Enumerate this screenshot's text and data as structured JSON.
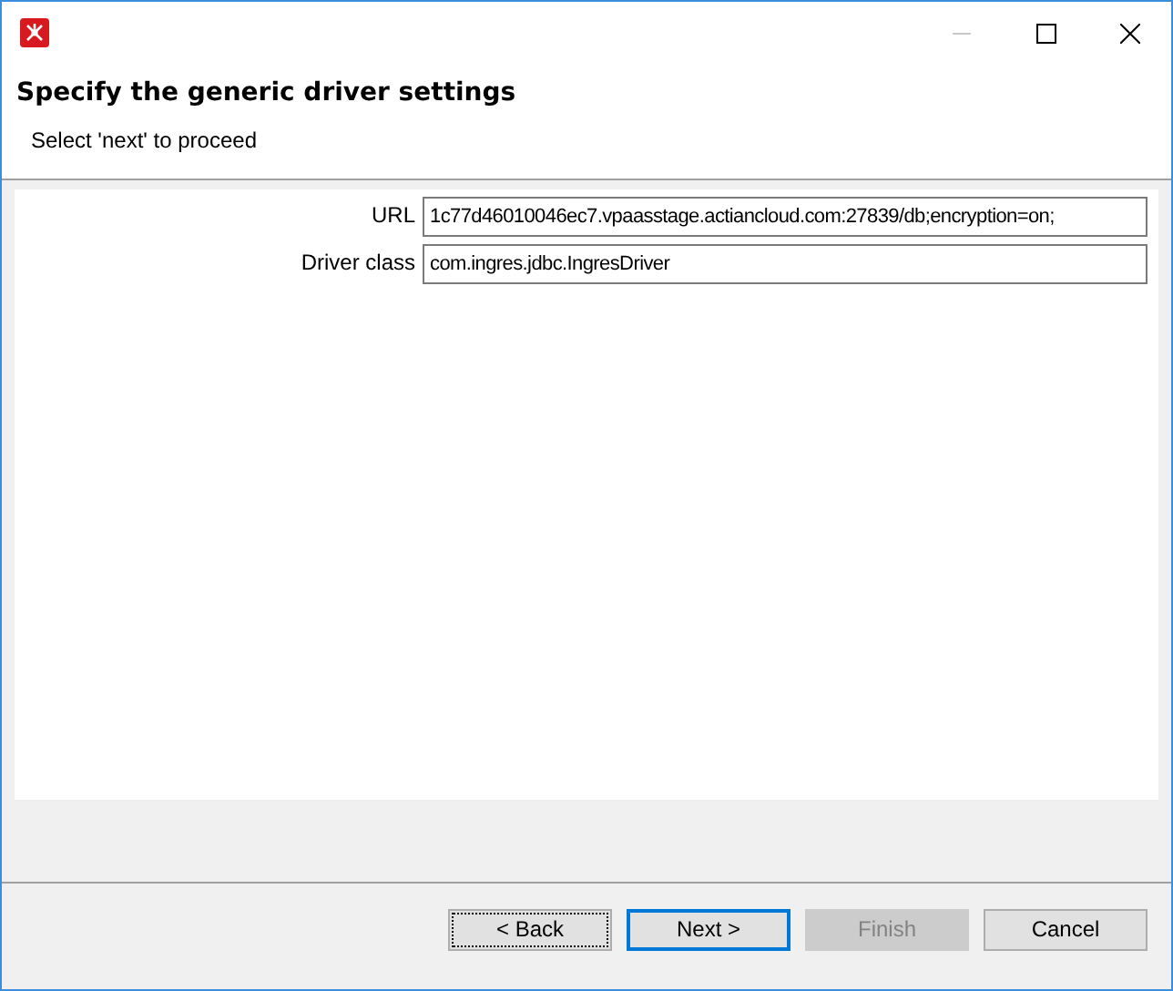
{
  "header": {
    "title": "Specify the generic driver settings",
    "subtitle": "Select 'next' to proceed"
  },
  "fields": [
    {
      "label": "URL",
      "value": "1c77d46010046ec7.vpaasstage.actiancloud.com:27839/db;encryption=on;"
    },
    {
      "label": "Driver class",
      "value": "com.ingres.jdbc.IngresDriver"
    }
  ],
  "buttons": [
    {
      "label": "< Back",
      "focused": true,
      "default": false,
      "disabled": false
    },
    {
      "label": "Next >",
      "focused": false,
      "default": true,
      "disabled": false
    },
    {
      "label": "Finish",
      "focused": false,
      "default": false,
      "disabled": true
    },
    {
      "label": "Cancel",
      "focused": false,
      "default": false,
      "disabled": false
    }
  ]
}
